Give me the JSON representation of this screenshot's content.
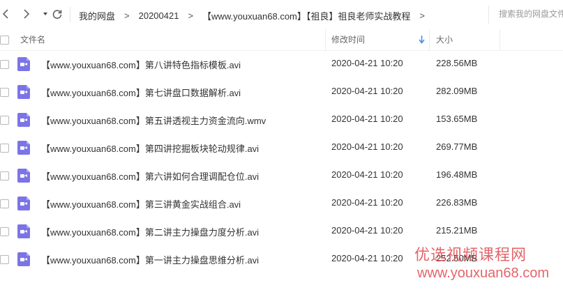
{
  "toolbar": {
    "back_icon": "chevron-left-icon",
    "forward_icon": "chevron-right-icon",
    "history_icon": "caret-down-icon",
    "refresh_icon": "refresh-icon"
  },
  "breadcrumb": {
    "items": [
      "我的网盘",
      "20200421",
      "【www.youxuan68.com】【祖良】祖良老师实战教程"
    ],
    "separator": ">"
  },
  "search": {
    "placeholder": "搜索我的网盘文件"
  },
  "columns": {
    "name": "文件名",
    "modified": "修改时间",
    "size": "大小",
    "sort_icon": "arrow-down-icon"
  },
  "files": [
    {
      "name": "【www.youxuan68.com】第八讲特色指标模板.avi",
      "modified": "2020-04-21 10:20",
      "size": "228.56MB",
      "icon": "video-file-icon"
    },
    {
      "name": "【www.youxuan68.com】第七讲盘口数据解析.avi",
      "modified": "2020-04-21 10:20",
      "size": "282.09MB",
      "icon": "video-file-icon"
    },
    {
      "name": "【www.youxuan68.com】第五讲透视主力资金流向.wmv",
      "modified": "2020-04-21 10:20",
      "size": "153.65MB",
      "icon": "video-file-icon"
    },
    {
      "name": "【www.youxuan68.com】第四讲挖掘板块轮动规律.avi",
      "modified": "2020-04-21 10:20",
      "size": "269.77MB",
      "icon": "video-file-icon"
    },
    {
      "name": "【www.youxuan68.com】第六讲如何合理调配仓位.avi",
      "modified": "2020-04-21 10:20",
      "size": "196.48MB",
      "icon": "video-file-icon"
    },
    {
      "name": "【www.youxuan68.com】第三讲黄金实战组合.avi",
      "modified": "2020-04-21 10:20",
      "size": "226.83MB",
      "icon": "video-file-icon"
    },
    {
      "name": "【www.youxuan68.com】第二讲主力操盘力度分析.avi",
      "modified": "2020-04-21 10:20",
      "size": "215.21MB",
      "icon": "video-file-icon"
    },
    {
      "name": "【www.youxuan68.com】第一讲主力操盘思维分析.avi",
      "modified": "2020-04-21 10:20",
      "size": "252.50MB",
      "icon": "video-file-icon"
    }
  ],
  "watermark": {
    "line1": "优选视频课程网",
    "line2": "www.youxuan68.com",
    "color": "#e0555a"
  },
  "colors": {
    "file_icon": "#7b74e8",
    "sort_arrow": "#3b8cf0"
  }
}
